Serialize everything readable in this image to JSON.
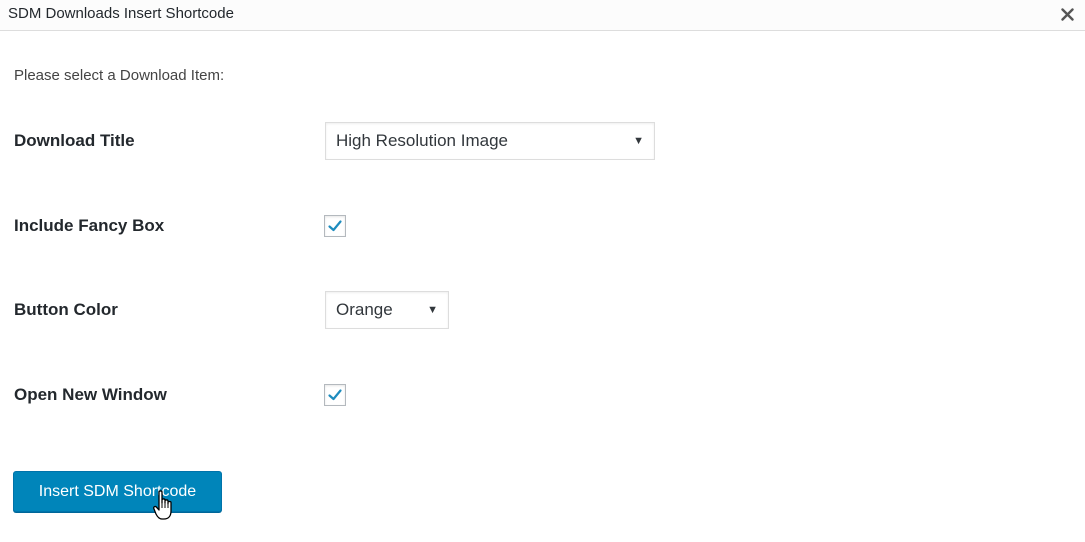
{
  "dialog": {
    "title": "SDM Downloads Insert Shortcode",
    "close_icon": "close-icon"
  },
  "form": {
    "prompt": "Please select a Download Item:",
    "download_title": {
      "label": "Download Title",
      "selected": "High Resolution Image"
    },
    "fancy_box": {
      "label": "Include Fancy Box",
      "checked": true
    },
    "button_color": {
      "label": "Button Color",
      "selected": "Orange"
    },
    "new_window": {
      "label": "Open New Window",
      "checked": true
    },
    "submit_label": "Insert SDM Shortcode"
  },
  "colors": {
    "primary_button": "#0085ba",
    "checkmark": "#1e8cbe"
  },
  "icons": {
    "dropdown": "chevron-down-icon",
    "check": "checkmark-icon",
    "pointer": "hand-pointer-cursor"
  }
}
